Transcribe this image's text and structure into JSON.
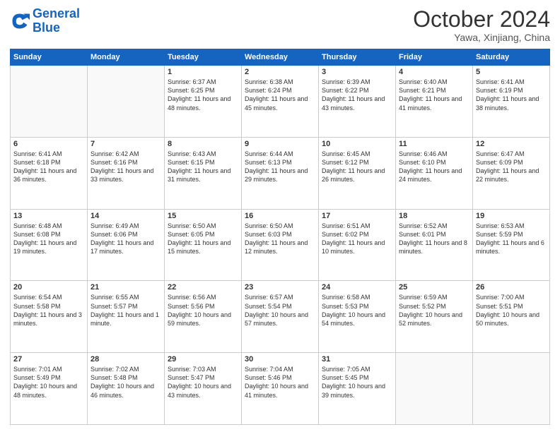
{
  "header": {
    "logo_line1": "General",
    "logo_line2": "Blue",
    "month": "October 2024",
    "location": "Yawa, Xinjiang, China"
  },
  "days_of_week": [
    "Sunday",
    "Monday",
    "Tuesday",
    "Wednesday",
    "Thursday",
    "Friday",
    "Saturday"
  ],
  "weeks": [
    [
      {
        "day": "",
        "info": ""
      },
      {
        "day": "",
        "info": ""
      },
      {
        "day": "1",
        "info": "Sunrise: 6:37 AM\nSunset: 6:25 PM\nDaylight: 11 hours and 48 minutes."
      },
      {
        "day": "2",
        "info": "Sunrise: 6:38 AM\nSunset: 6:24 PM\nDaylight: 11 hours and 45 minutes."
      },
      {
        "day": "3",
        "info": "Sunrise: 6:39 AM\nSunset: 6:22 PM\nDaylight: 11 hours and 43 minutes."
      },
      {
        "day": "4",
        "info": "Sunrise: 6:40 AM\nSunset: 6:21 PM\nDaylight: 11 hours and 41 minutes."
      },
      {
        "day": "5",
        "info": "Sunrise: 6:41 AM\nSunset: 6:19 PM\nDaylight: 11 hours and 38 minutes."
      }
    ],
    [
      {
        "day": "6",
        "info": "Sunrise: 6:41 AM\nSunset: 6:18 PM\nDaylight: 11 hours and 36 minutes."
      },
      {
        "day": "7",
        "info": "Sunrise: 6:42 AM\nSunset: 6:16 PM\nDaylight: 11 hours and 33 minutes."
      },
      {
        "day": "8",
        "info": "Sunrise: 6:43 AM\nSunset: 6:15 PM\nDaylight: 11 hours and 31 minutes."
      },
      {
        "day": "9",
        "info": "Sunrise: 6:44 AM\nSunset: 6:13 PM\nDaylight: 11 hours and 29 minutes."
      },
      {
        "day": "10",
        "info": "Sunrise: 6:45 AM\nSunset: 6:12 PM\nDaylight: 11 hours and 26 minutes."
      },
      {
        "day": "11",
        "info": "Sunrise: 6:46 AM\nSunset: 6:10 PM\nDaylight: 11 hours and 24 minutes."
      },
      {
        "day": "12",
        "info": "Sunrise: 6:47 AM\nSunset: 6:09 PM\nDaylight: 11 hours and 22 minutes."
      }
    ],
    [
      {
        "day": "13",
        "info": "Sunrise: 6:48 AM\nSunset: 6:08 PM\nDaylight: 11 hours and 19 minutes."
      },
      {
        "day": "14",
        "info": "Sunrise: 6:49 AM\nSunset: 6:06 PM\nDaylight: 11 hours and 17 minutes."
      },
      {
        "day": "15",
        "info": "Sunrise: 6:50 AM\nSunset: 6:05 PM\nDaylight: 11 hours and 15 minutes."
      },
      {
        "day": "16",
        "info": "Sunrise: 6:50 AM\nSunset: 6:03 PM\nDaylight: 11 hours and 12 minutes."
      },
      {
        "day": "17",
        "info": "Sunrise: 6:51 AM\nSunset: 6:02 PM\nDaylight: 11 hours and 10 minutes."
      },
      {
        "day": "18",
        "info": "Sunrise: 6:52 AM\nSunset: 6:01 PM\nDaylight: 11 hours and 8 minutes."
      },
      {
        "day": "19",
        "info": "Sunrise: 6:53 AM\nSunset: 5:59 PM\nDaylight: 11 hours and 6 minutes."
      }
    ],
    [
      {
        "day": "20",
        "info": "Sunrise: 6:54 AM\nSunset: 5:58 PM\nDaylight: 11 hours and 3 minutes."
      },
      {
        "day": "21",
        "info": "Sunrise: 6:55 AM\nSunset: 5:57 PM\nDaylight: 11 hours and 1 minute."
      },
      {
        "day": "22",
        "info": "Sunrise: 6:56 AM\nSunset: 5:56 PM\nDaylight: 10 hours and 59 minutes."
      },
      {
        "day": "23",
        "info": "Sunrise: 6:57 AM\nSunset: 5:54 PM\nDaylight: 10 hours and 57 minutes."
      },
      {
        "day": "24",
        "info": "Sunrise: 6:58 AM\nSunset: 5:53 PM\nDaylight: 10 hours and 54 minutes."
      },
      {
        "day": "25",
        "info": "Sunrise: 6:59 AM\nSunset: 5:52 PM\nDaylight: 10 hours and 52 minutes."
      },
      {
        "day": "26",
        "info": "Sunrise: 7:00 AM\nSunset: 5:51 PM\nDaylight: 10 hours and 50 minutes."
      }
    ],
    [
      {
        "day": "27",
        "info": "Sunrise: 7:01 AM\nSunset: 5:49 PM\nDaylight: 10 hours and 48 minutes."
      },
      {
        "day": "28",
        "info": "Sunrise: 7:02 AM\nSunset: 5:48 PM\nDaylight: 10 hours and 46 minutes."
      },
      {
        "day": "29",
        "info": "Sunrise: 7:03 AM\nSunset: 5:47 PM\nDaylight: 10 hours and 43 minutes."
      },
      {
        "day": "30",
        "info": "Sunrise: 7:04 AM\nSunset: 5:46 PM\nDaylight: 10 hours and 41 minutes."
      },
      {
        "day": "31",
        "info": "Sunrise: 7:05 AM\nSunset: 5:45 PM\nDaylight: 10 hours and 39 minutes."
      },
      {
        "day": "",
        "info": ""
      },
      {
        "day": "",
        "info": ""
      }
    ]
  ]
}
